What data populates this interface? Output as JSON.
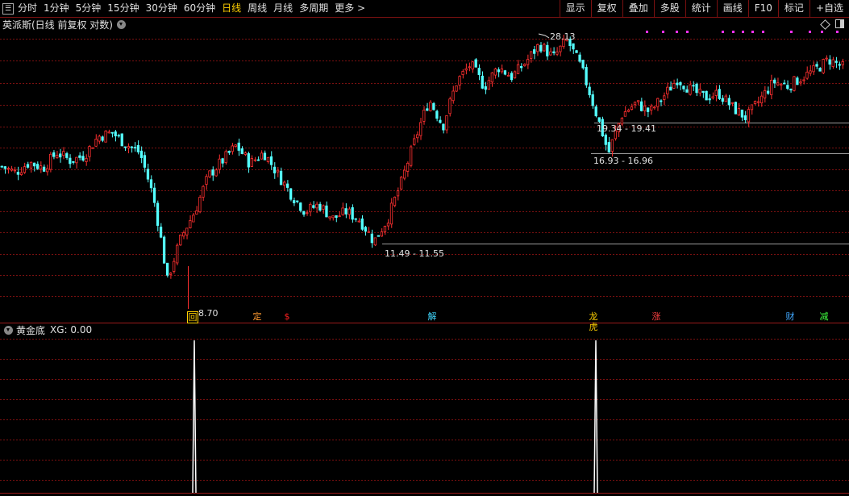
{
  "toolbar": {
    "periods": [
      "分时",
      "1分钟",
      "5分钟",
      "15分钟",
      "30分钟",
      "60分钟",
      "日线",
      "周线",
      "月线",
      "多周期",
      "更多 >"
    ],
    "active_period": "日线",
    "tools": [
      "显示",
      "复权",
      "叠加",
      "多股",
      "统计",
      "画线",
      "F10",
      "标记",
      "+自选"
    ]
  },
  "stock": {
    "title": "英派斯(日线 前复权 对数)"
  },
  "annotations": {
    "high": "28.13",
    "low": "8.70",
    "zone1": "19.34 - 19.41",
    "zone2": "16.93 - 16.96",
    "zone3": "11.49 - 11.55"
  },
  "signals": [
    {
      "text": "回",
      "color": "#ffd000"
    },
    {
      "text": "定",
      "color": "#ff9a30"
    },
    {
      "text": "$",
      "color": "#ff2020"
    },
    {
      "text": "解",
      "color": "#40d8ff"
    },
    {
      "text": "龙虎",
      "color": "#ffd000"
    },
    {
      "text": "涨",
      "color": "#ff4040"
    },
    {
      "text": "财",
      "color": "#40a8ff"
    },
    {
      "text": "减",
      "color": "#40ff40"
    }
  ],
  "indicator": {
    "name": "黄金底",
    "value_label": "XG: 0.00",
    "spikes": [
      1,
      1
    ]
  },
  "colors": {
    "up": "#ff3030",
    "down": "#54ffff",
    "grid": "#7a1010"
  },
  "chart_data": {
    "type": "candlestick",
    "title": "英派斯(日线 前复权 对数)",
    "scale": "log",
    "visible_price_labels": {
      "high": 28.13,
      "low": 8.7
    },
    "support_zones": [
      [
        19.34,
        19.41
      ],
      [
        16.93,
        16.96
      ],
      [
        11.49,
        11.55
      ]
    ],
    "close_path_samples": [
      16.0,
      15.6,
      16.3,
      15.9,
      17.0,
      16.4,
      16.8,
      18.2,
      18.5,
      17.6,
      17.0,
      14.0,
      9.8,
      11.8,
      13.2,
      15.4,
      16.4,
      17.5,
      16.2,
      17.0,
      15.5,
      14.2,
      13.2,
      13.6,
      12.8,
      13.2,
      12.7,
      11.6,
      12.8,
      15.0,
      18.0,
      21.3,
      19.0,
      23.0,
      24.8,
      22.5,
      24.5,
      23.5,
      25.0,
      27.0,
      25.5,
      27.5,
      24.5,
      20.5,
      16.9,
      20.0,
      21.0,
      20.2,
      21.6,
      23.3,
      22.2,
      21.5,
      21.9,
      20.6,
      19.7,
      21.3,
      23.0,
      22.6,
      23.4,
      24.2,
      25.3,
      24.5
    ]
  }
}
